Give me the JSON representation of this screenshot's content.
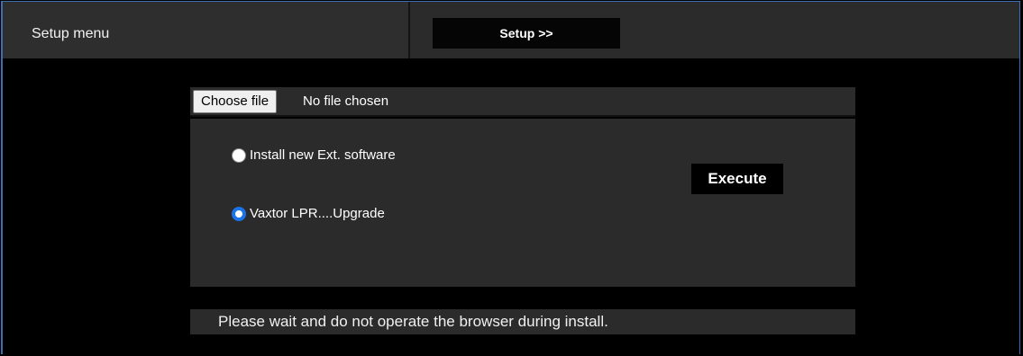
{
  "header": {
    "menu_title": "Setup menu",
    "setup_button": "Setup >>"
  },
  "file_upload": {
    "choose_button": "Choose file",
    "status": "No file chosen"
  },
  "options": [
    {
      "label": "Install new Ext. software",
      "checked": false
    },
    {
      "label": "Vaxtor LPR....Upgrade",
      "checked": true
    }
  ],
  "execute_label": "Execute",
  "notice": "Please wait and do not operate the browser during install.",
  "colors": {
    "background": "#000000",
    "panel": "#2b2b2b",
    "radio_accent": "#1a73e8",
    "frame_border": "#3d6fae"
  }
}
